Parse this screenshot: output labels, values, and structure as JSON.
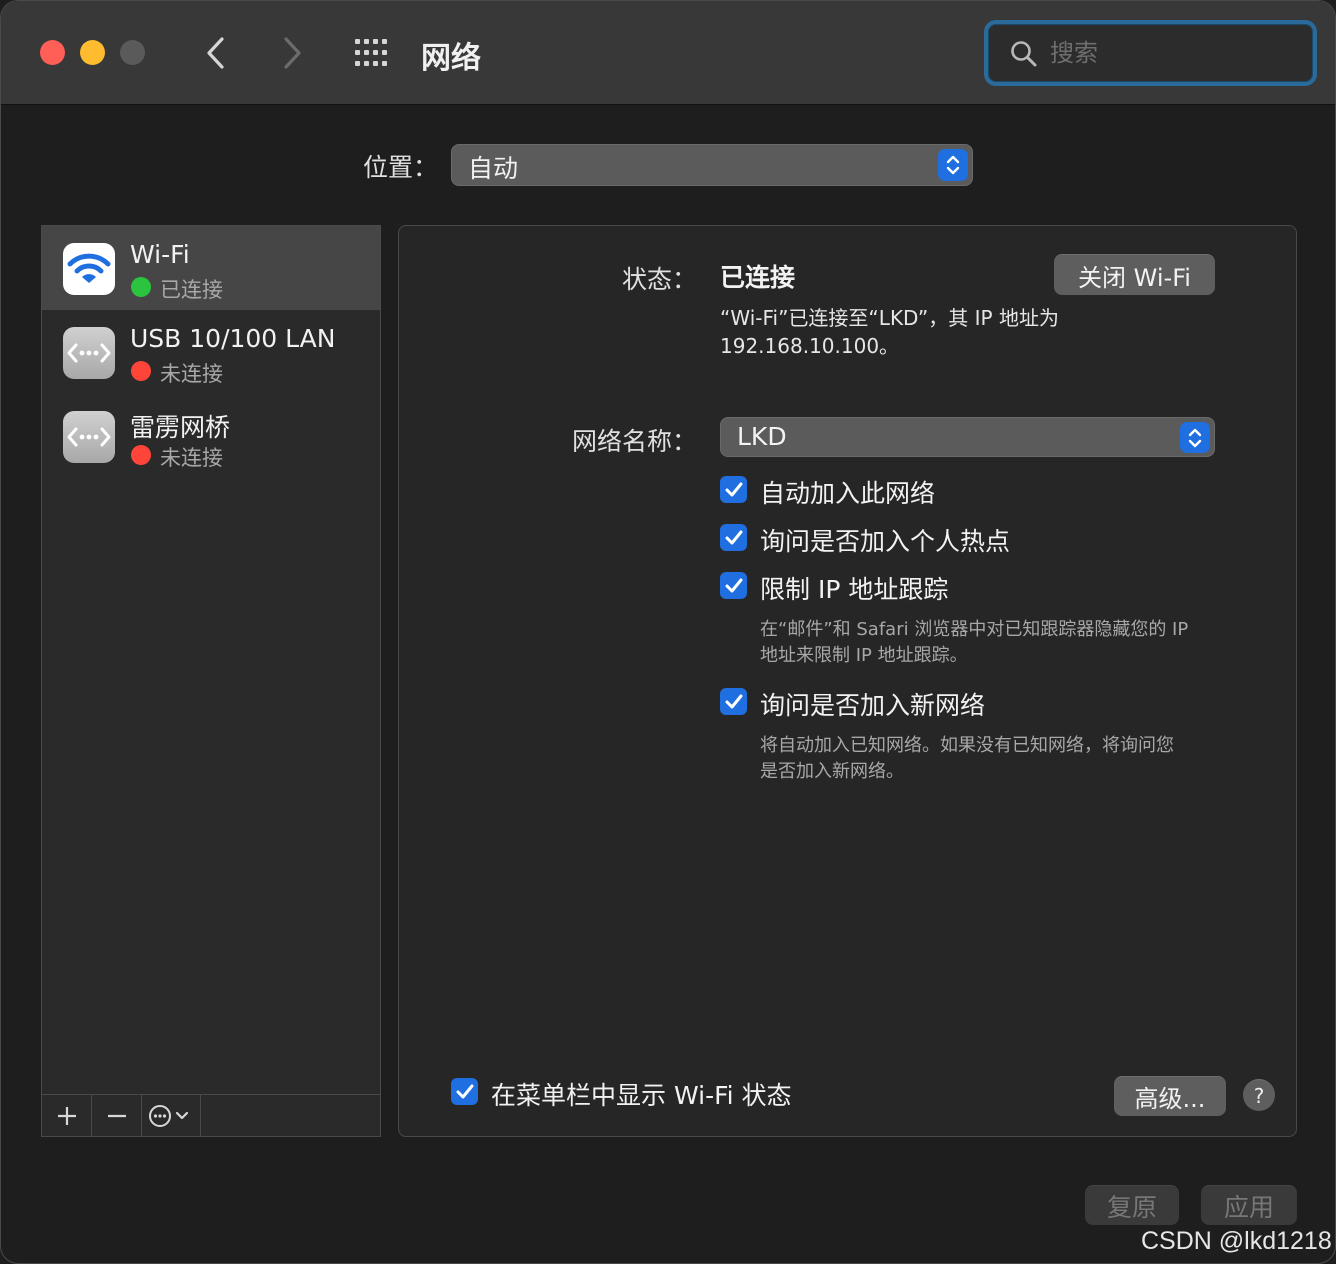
{
  "window": {
    "title": "网络",
    "search_placeholder": "搜索"
  },
  "location": {
    "label": "位置：",
    "value": "自动"
  },
  "sidebar": {
    "services": [
      {
        "name": "Wi-Fi",
        "status": "已连接",
        "status_color": "#2ac43f",
        "icon": "wifi-icon",
        "selected": true
      },
      {
        "name": "USB 10/100 LAN",
        "status": "未连接",
        "status_color": "#ff453a",
        "icon": "ethernet-icon",
        "selected": false
      },
      {
        "name": "雷雳网桥",
        "status": "未连接",
        "status_color": "#ff453a",
        "icon": "ethernet-icon",
        "selected": false
      }
    ],
    "toolbar": {
      "add": "+",
      "remove": "−"
    }
  },
  "detail": {
    "status_label": "状态：",
    "status_value": "已连接",
    "wifi_off_button": "关闭 Wi-Fi",
    "status_desc_line1": "“Wi-Fi”已连接至“LKD”，其 IP 地址为",
    "status_desc_line2": "192.168.10.100。",
    "network_name_label": "网络名称：",
    "network_name_value": "LKD",
    "checkboxes": [
      {
        "label": "自动加入此网络",
        "checked": true,
        "desc_line1": "",
        "desc_line2": ""
      },
      {
        "label": "询问是否加入个人热点",
        "checked": true,
        "desc_line1": "",
        "desc_line2": ""
      },
      {
        "label": "限制 IP 地址跟踪",
        "checked": true,
        "desc_line1": "在“邮件”和 Safari 浏览器中对已知跟踪器隐藏您的 IP",
        "desc_line2": "地址来限制 IP 地址跟踪。"
      },
      {
        "label": "询问是否加入新网络",
        "checked": true,
        "desc_line1": "将自动加入已知网络。如果没有已知网络，将询问您",
        "desc_line2": "是否加入新网络。"
      }
    ],
    "menubar_checkbox_label": "在菜单栏中显示 Wi-Fi 状态",
    "menubar_checked": true,
    "advanced_button": "高级...",
    "help_button": "?"
  },
  "footer": {
    "revert_button": "复原",
    "apply_button": "应用"
  },
  "watermark": "CSDN @lkd1218",
  "colors": {
    "accent": "#1f6fe0",
    "connected": "#2ac43f",
    "disconnected": "#ff453a",
    "close": "#ff5f57",
    "minimize": "#febc2e"
  }
}
